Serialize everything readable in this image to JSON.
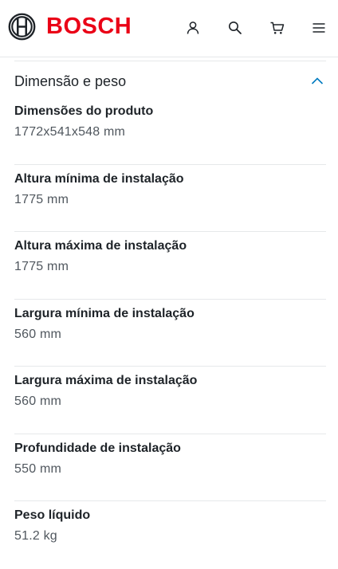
{
  "header": {
    "brand": "BOSCH",
    "icons": [
      "user-icon",
      "search-icon",
      "cart-icon",
      "menu-icon"
    ]
  },
  "section": {
    "title": "Dimensão e peso",
    "expanded": true
  },
  "specs": [
    {
      "label": "Dimensões do produto",
      "value": "1772x541x548 mm"
    },
    {
      "label": "Altura mínima de instalação",
      "value": "1775 mm"
    },
    {
      "label": "Altura máxima de instalação",
      "value": "1775 mm"
    },
    {
      "label": "Largura mínima de instalação",
      "value": "560 mm"
    },
    {
      "label": "Largura máxima de instalação",
      "value": "560 mm"
    },
    {
      "label": "Profundidade de instalação",
      "value": "550 mm"
    },
    {
      "label": "Peso líquido",
      "value": "51.2 kg"
    }
  ],
  "colors": {
    "brand_red": "#ea0016",
    "accent_blue": "#007bc0",
    "text": "#1e2328",
    "muted": "#50575e",
    "divider": "#e6e8ea"
  }
}
